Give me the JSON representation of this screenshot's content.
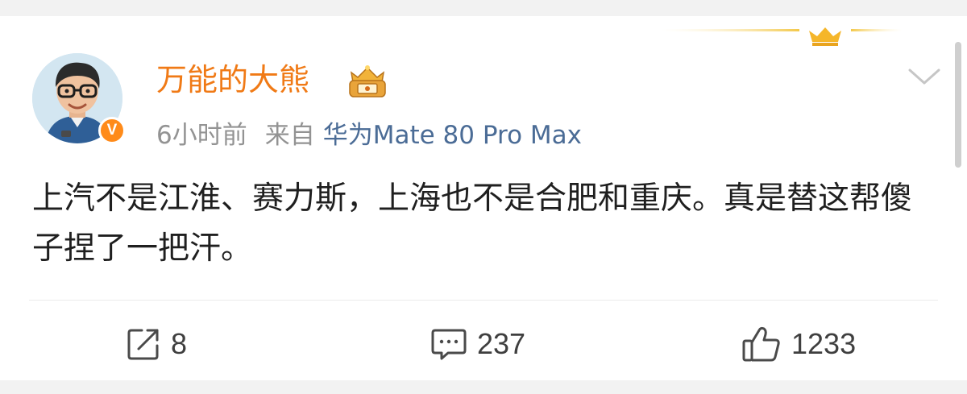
{
  "post": {
    "author": {
      "name": "万能的大熊",
      "verified_badge": "V",
      "avatar_icon": "avatar-cartoon-man-with-glasses",
      "level_badge_icon": "crown-badge-icon"
    },
    "meta": {
      "time": "6小时前",
      "from_label": "来自",
      "device": "华为Mate 80 Pro Max"
    },
    "content": "上汽不是江淮、赛力斯，上海也不是合肥和重庆。真是替这帮傻子捏了一把汗。",
    "actions": {
      "repost_count": "8",
      "comment_count": "237",
      "like_count": "1233"
    }
  },
  "colors": {
    "username": "#f07a16",
    "device_link": "#4b6c96",
    "meta_text": "#939393",
    "verified_badge": "#ff8b1a",
    "background": "#f2f2f2"
  }
}
